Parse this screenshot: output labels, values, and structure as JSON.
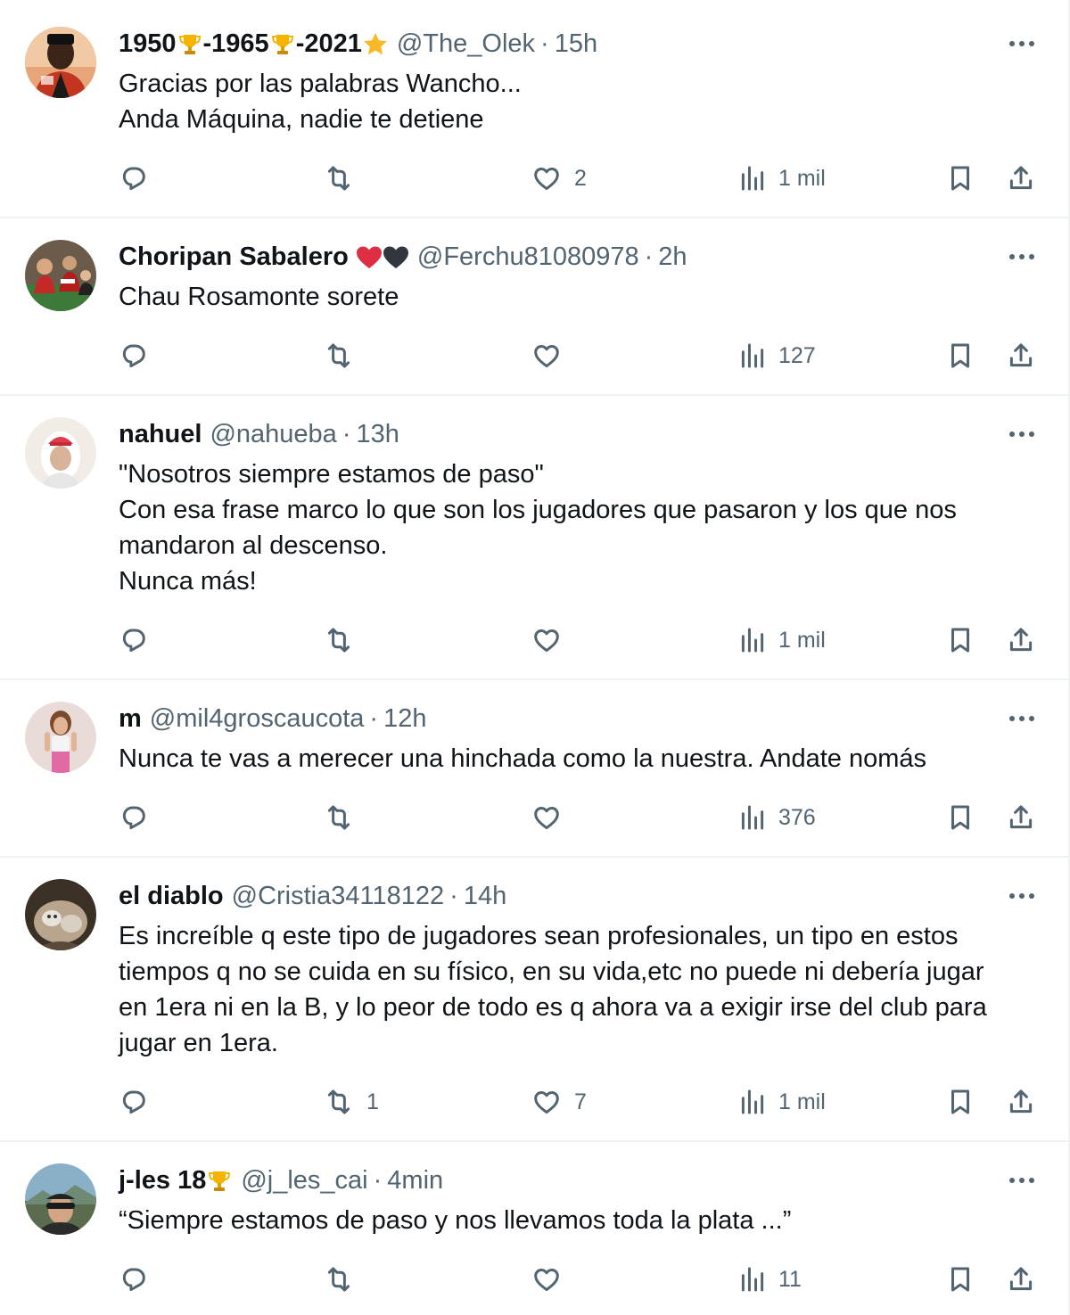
{
  "tweets": [
    {
      "name_parts": [
        "1950",
        "-1965",
        "-2021"
      ],
      "name_emoji": [
        "trophy",
        "trophy",
        "star"
      ],
      "handle": "@The_Olek",
      "time": "15h",
      "text": "Gracias por las palabras Wancho...\nAnda Máquina, nadie te detiene",
      "replies": "",
      "retweets": "",
      "likes": "2",
      "views": "1 mil"
    },
    {
      "name": "Choripan Sabalero",
      "name_emoji": [
        "red-heart",
        "black-heart"
      ],
      "handle": "@Ferchu81080978",
      "time": "2h",
      "text": "Chau Rosamonte sorete",
      "replies": "",
      "retweets": "",
      "likes": "",
      "views": "127"
    },
    {
      "name": "nahuel",
      "handle": "@nahueba",
      "time": "13h",
      "text": "\"Nosotros siempre estamos de paso\"\nCon esa frase marco lo que son los jugadores que pasaron y los que nos\nmandaron al descenso.\nNunca más!",
      "replies": "",
      "retweets": "",
      "likes": "",
      "views": "1 mil"
    },
    {
      "name": "m",
      "handle": "@mil4groscaucota",
      "time": "12h",
      "text": "Nunca te vas a merecer una hinchada como la nuestra. Andate nomás",
      "replies": "",
      "retweets": "",
      "likes": "",
      "views": "376"
    },
    {
      "name": "el diablo",
      "handle": "@Cristia34118122",
      "time": "14h",
      "text": "Es increíble q este tipo de jugadores sean profesionales, un tipo en estos\ntiempos q no se cuida en su físico, en su vida,etc no puede ni debería jugar\nen 1era ni en la B, y lo peor de todo es q ahora va a exigir irse del club para\njugar en 1era.",
      "replies": "",
      "retweets": "1",
      "likes": "7",
      "views": "1 mil"
    },
    {
      "name": "j-les 18",
      "name_emoji": [
        "trophy"
      ],
      "handle": "@j_les_cai",
      "time": "4min",
      "text": "“Siempre estamos de paso y nos llevamos toda la plata ...”",
      "replies": "",
      "retweets": "",
      "likes": "",
      "views": "11"
    }
  ],
  "separator": "·",
  "icons": {
    "more": "more-icon",
    "reply": "reply-icon",
    "retweet": "retweet-icon",
    "like": "heart-icon",
    "views": "views-icon",
    "bookmark": "bookmark-icon",
    "share": "share-icon"
  },
  "colors": {
    "text": "#0f1419",
    "secondary": "#536471",
    "divider": "#eff3f4"
  }
}
